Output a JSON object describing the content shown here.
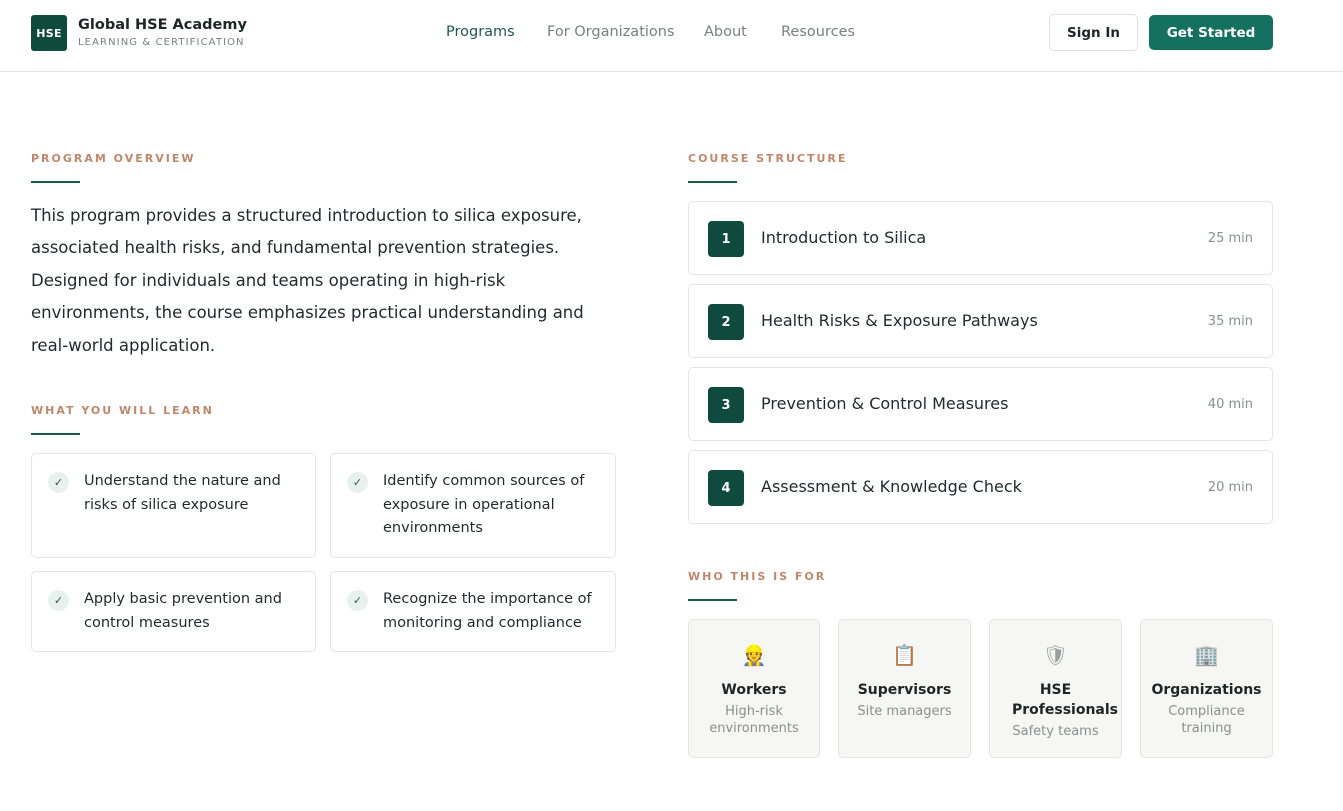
{
  "header": {
    "logo_text": "HSE",
    "brand_title": "Global HSE Academy",
    "brand_subtitle": "LEARNING & CERTIFICATION",
    "nav": [
      "Programs",
      "For Organizations",
      "About",
      "Resources"
    ],
    "sign_in": "Sign In",
    "get_started": "Get Started"
  },
  "overview": {
    "label": "PROGRAM OVERVIEW",
    "text": "This program provides a structured introduction to silica exposure, associated health risks, and fundamental prevention strategies. Designed for individuals and teams operating in high-risk environments, the course emphasizes practical understanding and real-world application."
  },
  "learn": {
    "label": "WHAT YOU WILL LEARN",
    "check": "✓",
    "items": [
      "Understand the nature and risks of silica exposure",
      "Identify common sources of exposure in operational environments",
      "Apply basic prevention and control measures",
      "Recognize the importance of monitoring and compliance"
    ]
  },
  "course": {
    "label": "COURSE STRUCTURE",
    "modules": [
      {
        "num": "1",
        "title": "Introduction to Silica",
        "duration": "25 min"
      },
      {
        "num": "2",
        "title": "Health Risks & Exposure Pathways",
        "duration": "35 min"
      },
      {
        "num": "3",
        "title": "Prevention & Control Measures",
        "duration": "40 min"
      },
      {
        "num": "4",
        "title": "Assessment & Knowledge Check",
        "duration": "20 min"
      }
    ]
  },
  "audience": {
    "label": "WHO THIS IS FOR",
    "items": [
      {
        "icon": "👷",
        "title": "Workers",
        "subtitle": "High-risk environments"
      },
      {
        "icon": "📋",
        "title": "Supervisors",
        "subtitle": "Site managers"
      },
      {
        "icon": "🛡",
        "title": "HSE Professionals",
        "subtitle": "Safety teams"
      },
      {
        "icon": "🏢",
        "title": "Organizations",
        "subtitle": "Compliance training"
      }
    ]
  },
  "colors": {
    "brand_dark": "#0f4a3f",
    "brand": "#14705f",
    "accent_label": "#c0876a"
  }
}
